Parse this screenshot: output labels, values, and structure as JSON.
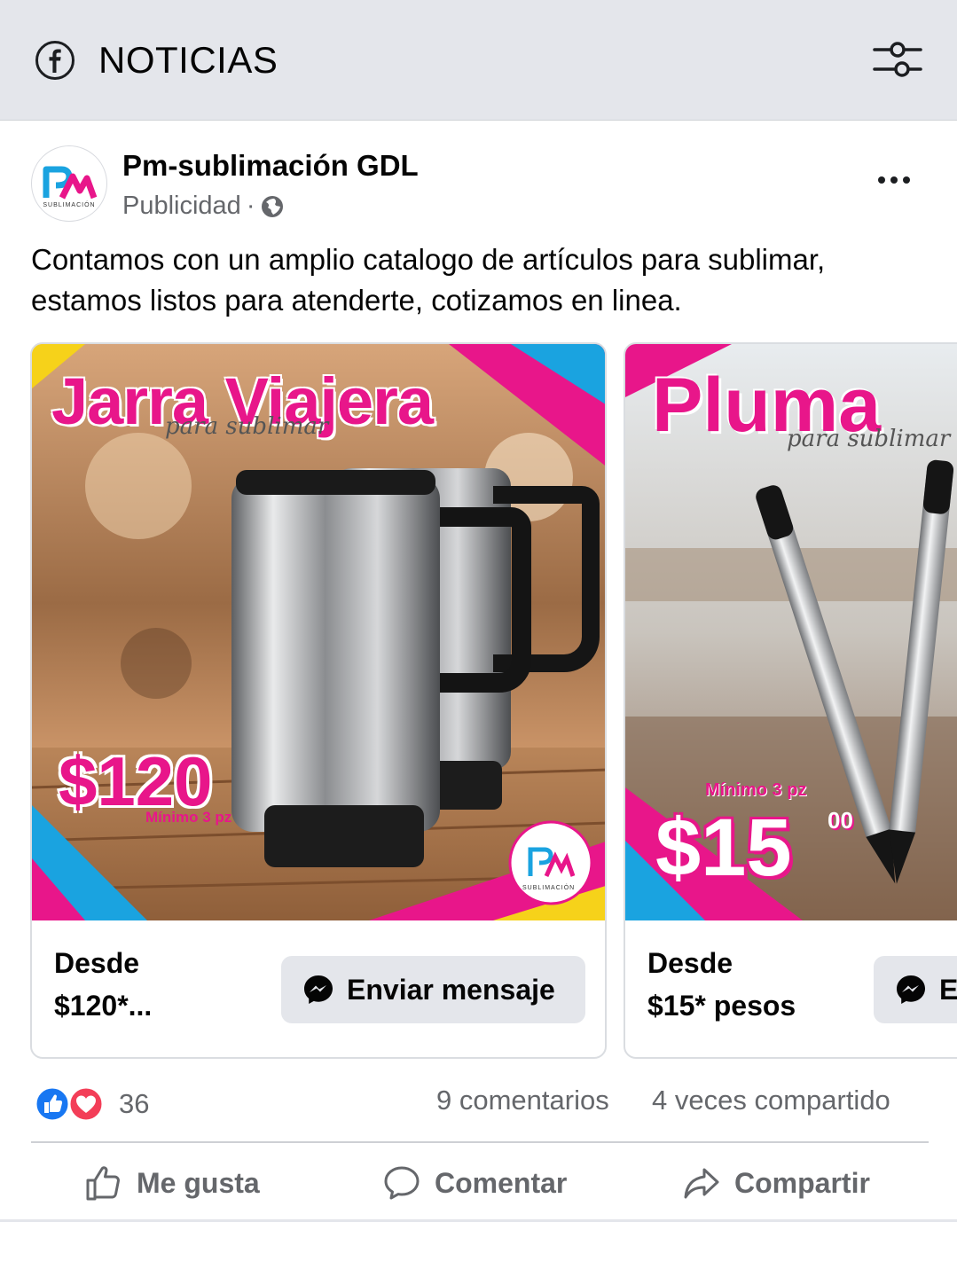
{
  "topbar": {
    "title": "NOTICIAS",
    "left_icon": "facebook-icon",
    "right_icon": "filter-icon"
  },
  "post": {
    "page_name": "Pm-sublimación GDL",
    "sponsored": "Publicidad",
    "separator": "·",
    "text": "Contamos con un amplio catalogo de artículos para sublimar, estamos listos para atenderte, cotizamos en linea.",
    "avatar_text": "SUBLIMACIÓN"
  },
  "carousel": [
    {
      "image": {
        "title": "Jarra Viajera",
        "subtitle": "para sublimar",
        "price": "$120",
        "minimum": "Mínimo 3 pz",
        "logo_text": "SUBLIMACIÓN"
      },
      "description": "Desde $120*...",
      "desc_line1": "Desde",
      "desc_line2": "$120*...",
      "cta_label": "Enviar mensaje"
    },
    {
      "image": {
        "title": "Pluma",
        "subtitle": "para sublimar",
        "price": "$15",
        "price_cents": "00",
        "minimum": "Mínimo 3 pz"
      },
      "desc_line1": "Desde",
      "desc_line2": "$15* pesos",
      "cta_label": "E"
    }
  ],
  "reactions": {
    "count": "36",
    "comments": "9 comentarios",
    "shares": "4 veces compartido"
  },
  "actions": {
    "like": "Me gusta",
    "comment": "Comentar",
    "share": "Compartir"
  },
  "colors": {
    "brand_pink": "#e8168a",
    "brand_blue": "#1aa3e0",
    "messenger": "#050505",
    "like_blue": "#1877f2",
    "love_red": "#f33e58"
  }
}
